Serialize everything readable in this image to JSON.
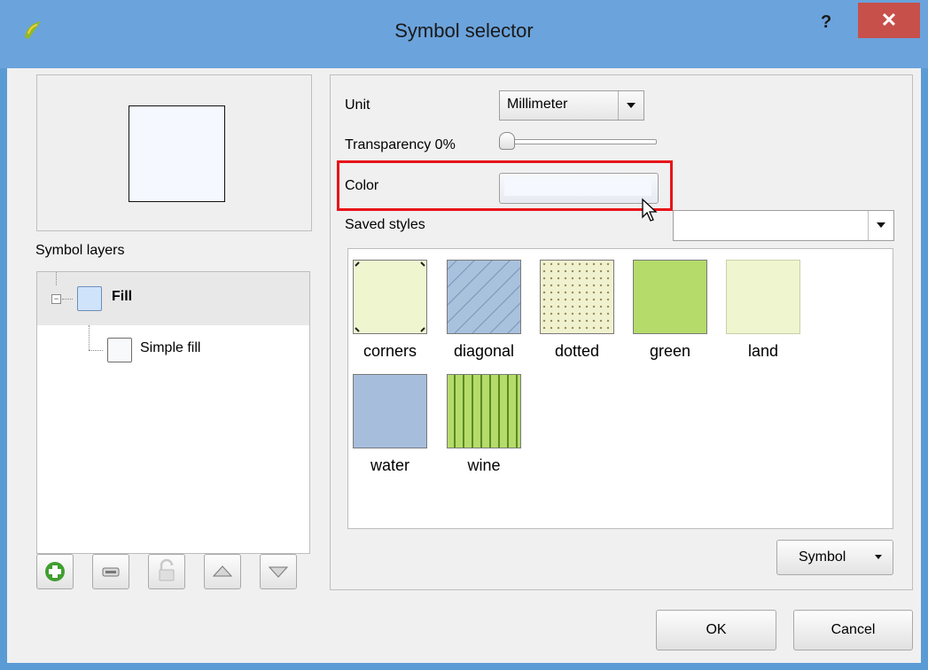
{
  "window": {
    "title": "Symbol selector",
    "help_label": "?",
    "close_label": "✕"
  },
  "layers_panel": {
    "label": "Symbol layers",
    "items": [
      {
        "label": "Fill"
      },
      {
        "label": "Simple fill"
      }
    ],
    "toolbar_icons": [
      "add-layer-icon",
      "remove-layer-icon",
      "lock-icon",
      "move-up-icon",
      "move-down-icon"
    ]
  },
  "properties": {
    "unit_label": "Unit",
    "unit_value": "Millimeter",
    "transparency_label": "Transparency 0%",
    "transparency_value": 0,
    "color_label": "Color",
    "color_value": "#f5f9ff",
    "saved_styles_label": "Saved styles",
    "saved_styles_value": "",
    "symbol_button_label": "Symbol"
  },
  "styles": [
    {
      "name": "corners",
      "color": "#eef5cf"
    },
    {
      "name": "diagonal",
      "color": "#a8c1dd"
    },
    {
      "name": "dotted",
      "color": "#f0f2cf"
    },
    {
      "name": "green",
      "color": "#b5db6a"
    },
    {
      "name": "land",
      "color": "#eef5cf"
    },
    {
      "name": "water",
      "color": "#a6bedc"
    },
    {
      "name": "wine",
      "color": "#b5db6a"
    }
  ],
  "footer": {
    "ok_label": "OK",
    "cancel_label": "Cancel"
  },
  "colors": {
    "highlight": "#e8141a",
    "titlebar": "#6ba3dc",
    "close_button": "#c7504b"
  }
}
